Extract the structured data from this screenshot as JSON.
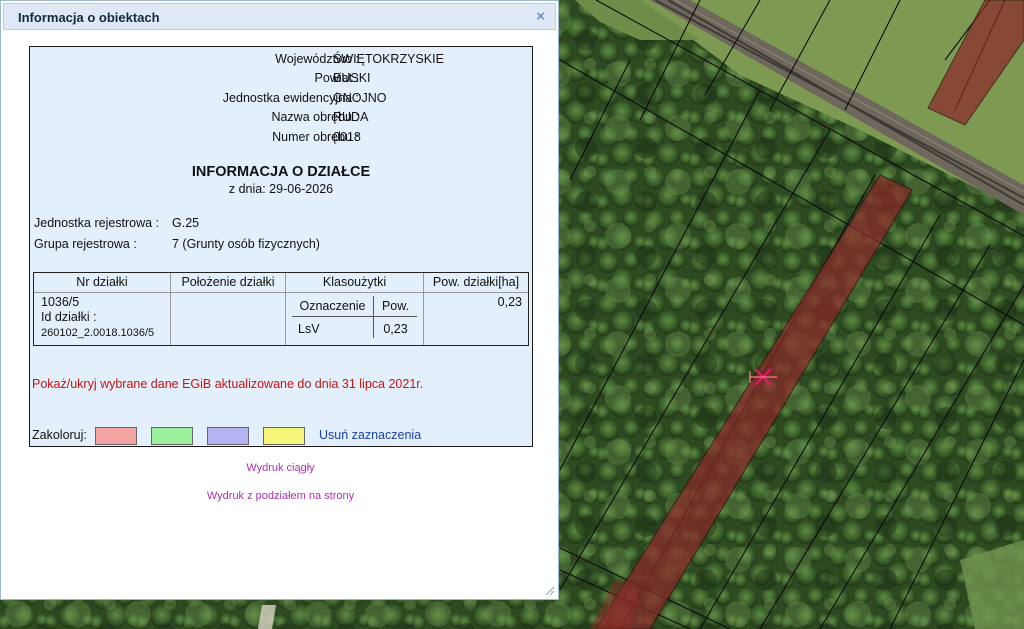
{
  "dialog": {
    "title": "Informacja o obiektach",
    "close_glyph": "×",
    "admin": [
      {
        "label": "Województwo :",
        "value": "ŚWIĘTOKRZYSKIE"
      },
      {
        "label": "Powiat :",
        "value": "BUSKI"
      },
      {
        "label": "Jednostka ewidencyjna :",
        "value": "GNOJNO"
      },
      {
        "label": "Nazwa obrębu :",
        "value": "RUDA"
      },
      {
        "label": "Numer obrębu :",
        "value": "0018"
      }
    ],
    "heading": "INFORMACJA O DZIAŁCE",
    "heading_date": "z dnia: 29-06-2026",
    "registry": [
      {
        "label": "Jednostka rejestrowa :",
        "value": "G.25"
      },
      {
        "label": "Grupa rejestrowa :",
        "value": "7 (Grunty osób fizycznych)"
      }
    ],
    "table": {
      "headers": [
        "Nr działki",
        "Położenie działki",
        "Klasoużytki",
        "Pow. działki[ha]"
      ],
      "parcel_number": "1036/5",
      "parcel_id_label": "Id działki :",
      "parcel_id": "260102_2.0018.1036/5",
      "location": "",
      "class_headers": [
        "Oznaczenie",
        "Pow."
      ],
      "class_rows": [
        {
          "code": "LsV",
          "area": "0,23"
        }
      ],
      "area": "0,23"
    },
    "egib_link": "Pokaż/ukryj wybrane dane EGiB aktualizowane do dnia 31 lipca 2021r.",
    "colorize_label": "Zakoloruj:",
    "swatches": [
      "#f4a3a3",
      "#9cf09c",
      "#b3b3f4",
      "#f6f67a"
    ],
    "clear_link": "Usuń zaznaczenia",
    "print_continuous": "Wydruk ciągły",
    "print_pages": "Wydruk z podziałem na strony"
  },
  "map": {
    "parcel_highlight_color": "#8b2a2a",
    "marker_color": "#e8156a",
    "marker_icon": "cross-marker-icon"
  }
}
